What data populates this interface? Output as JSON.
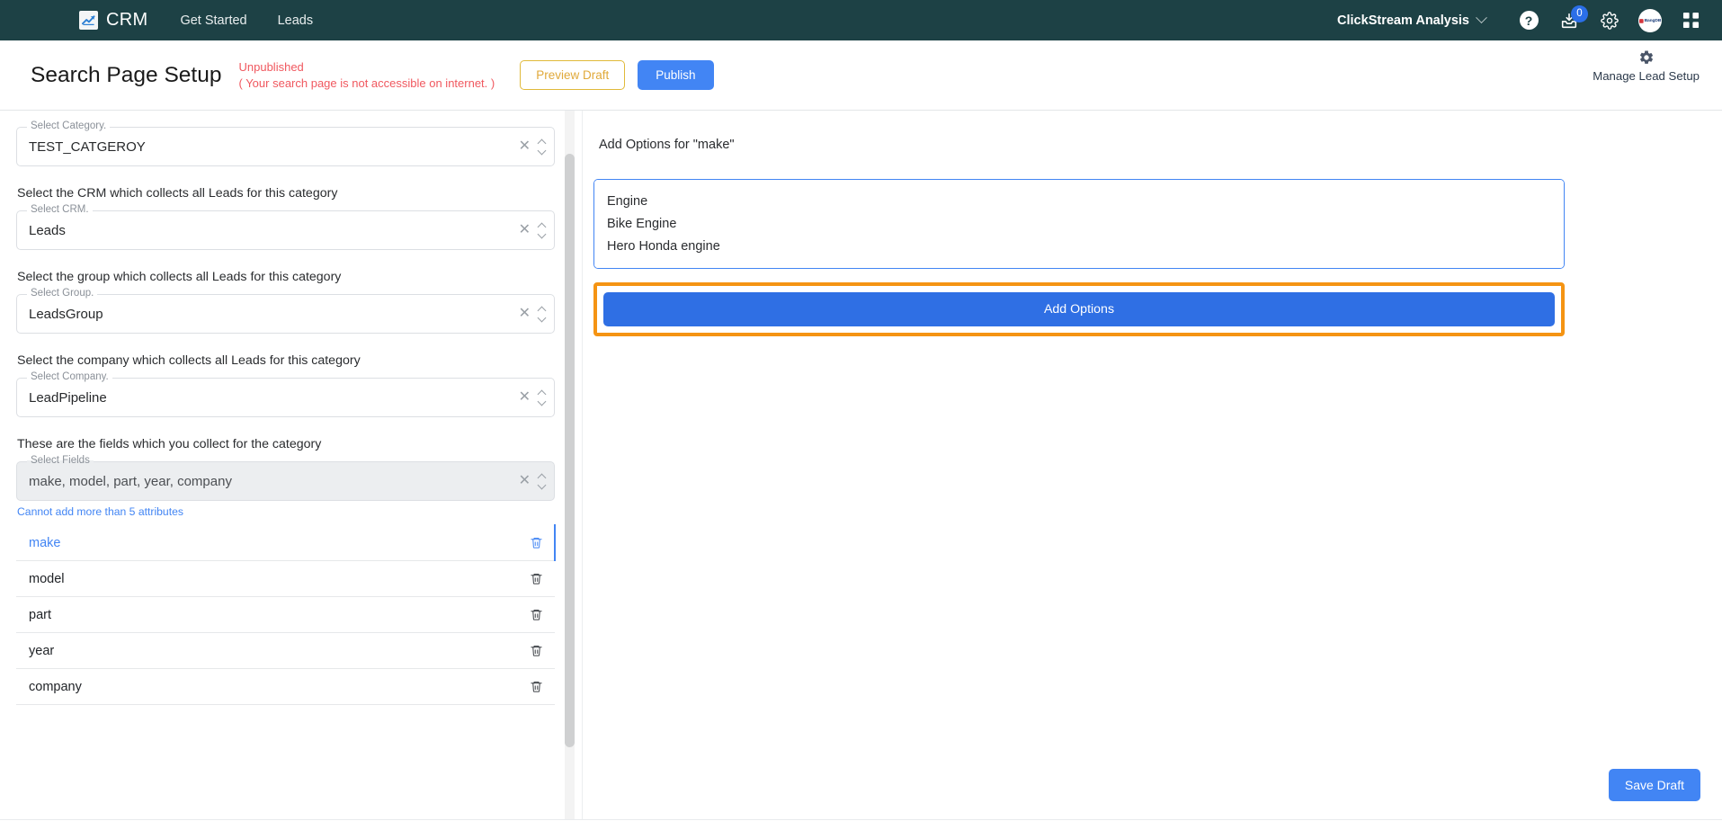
{
  "navbar": {
    "logo_icon": "chart-trend-icon",
    "brand": "CRM",
    "links": [
      {
        "label": "Get Started"
      },
      {
        "label": "Leads"
      }
    ],
    "workspace": "ClickStream Analysis",
    "workspace_chevron_icon": "chevron-down-icon",
    "help_icon": "question-mark-icon",
    "inbox_icon": "inbox-download-icon",
    "inbox_badge": "0",
    "settings_icon": "gear-icon",
    "avatar_label": "BangDB",
    "apps_icon": "grid-apps-icon",
    "bg_color": "#1d4145",
    "badge_color": "#2b6fe8"
  },
  "header": {
    "title": "Search Page Setup",
    "status_title": "Unpublished",
    "status_note": "( Your search page is not accessible on internet. )",
    "status_color": "#f0585f",
    "preview_label": "Preview Draft",
    "publish_label": "Publish",
    "publish_color": "#4285f4",
    "preview_border_color": "#e0b93a",
    "manage_icon": "gear-icon",
    "manage_label": "Manage Lead Setup"
  },
  "left_panel": {
    "category_field": {
      "label": "Select Category.",
      "value": "TEST_CATGEROY",
      "clear_icon": "close-x-icon",
      "toggle_icon": "up-down-caret-icon",
      "disabled": false
    },
    "crm_helper": "Select the CRM which collects all Leads for this category",
    "crm_field": {
      "label": "Select CRM.",
      "value": "Leads",
      "clear_icon": "close-x-icon",
      "toggle_icon": "up-down-caret-icon",
      "disabled": false
    },
    "group_helper": "Select the group which collects all Leads for this category",
    "group_field": {
      "label": "Select Group.",
      "value": "LeadsGroup",
      "clear_icon": "close-x-icon",
      "toggle_icon": "up-down-caret-icon",
      "disabled": false
    },
    "company_helper": "Select the company which collects all Leads for this category",
    "company_field": {
      "label": "Select Company.",
      "value": "LeadPipeline",
      "clear_icon": "close-x-icon",
      "toggle_icon": "up-down-caret-icon",
      "disabled": false
    },
    "fields_helper": "These are the fields which you collect for the category",
    "fields_field": {
      "label": "Select Fields",
      "value": "make, model, part, year, company",
      "clear_icon": "close-x-icon",
      "toggle_icon": "up-down-caret-icon",
      "disabled": true
    },
    "fields_warning": "Cannot add more than 5 attributes",
    "warning_color": "#4285f4",
    "attributes": [
      {
        "name": "make",
        "selected": true,
        "delete_icon": "trash-icon"
      },
      {
        "name": "model",
        "selected": false,
        "delete_icon": "trash-icon"
      },
      {
        "name": "part",
        "selected": false,
        "delete_icon": "trash-icon"
      },
      {
        "name": "year",
        "selected": false,
        "delete_icon": "trash-icon"
      },
      {
        "name": "company",
        "selected": false,
        "delete_icon": "trash-icon"
      }
    ],
    "scrollbar": "vertical-scrollbar"
  },
  "right_panel": {
    "title": "Add Options for \"make\"",
    "textarea_value": "Engine\nBike Engine\nHero Honda engine",
    "textarea_focus_color": "#4285f4",
    "add_options_label": "Add Options",
    "add_options_color": "#2f6fe4",
    "highlight_color": "#f59413"
  },
  "footer": {
    "save_draft_label": "Save Draft",
    "save_draft_color": "#4285f4"
  }
}
